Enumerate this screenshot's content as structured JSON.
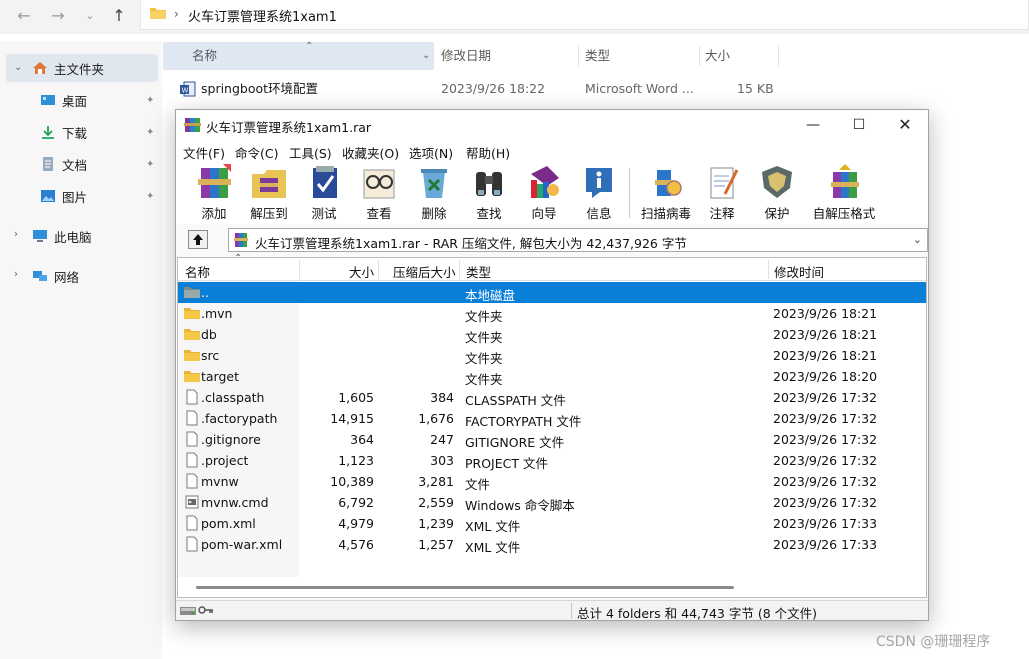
{
  "explorer": {
    "address_path": "火车订票管理系统1xam1",
    "sidebar": {
      "home": "主文件夹",
      "desktop": "桌面",
      "downloads": "下载",
      "documents": "文档",
      "pictures": "图片",
      "this_pc": "此电脑",
      "network": "网络"
    },
    "columns": {
      "name": "名称",
      "modified": "修改日期",
      "type": "类型",
      "size": "大小"
    },
    "file": {
      "name": "springboot环境配置",
      "modified": "2023/9/26 18:22",
      "type": "Microsoft Word ...",
      "size": "15 KB"
    }
  },
  "rar": {
    "title": "火车订票管理系统1xam1.rar",
    "menus": [
      "文件(F)",
      "命令(C)",
      "工具(S)",
      "收藏夹(O)",
      "选项(N)",
      "帮助(H)"
    ],
    "toolbar": [
      "添加",
      "解压到",
      "测试",
      "查看",
      "删除",
      "查找",
      "向导",
      "信息",
      "扫描病毒",
      "注释",
      "保护",
      "自解压格式"
    ],
    "path": "火车订票管理系统1xam1.rar - RAR 压缩文件, 解包大小为 42,437,926 字节",
    "columns": {
      "name": "名称",
      "size": "大小",
      "packed": "压缩后大小",
      "type": "类型",
      "modified": "修改时间"
    },
    "rows": [
      {
        "name": "..",
        "size": "",
        "packed": "",
        "type": "本地磁盘",
        "modified": "",
        "kind": "drive"
      },
      {
        "name": ".mvn",
        "size": "",
        "packed": "",
        "type": "文件夹",
        "modified": "2023/9/26 18:21",
        "kind": "folder"
      },
      {
        "name": "db",
        "size": "",
        "packed": "",
        "type": "文件夹",
        "modified": "2023/9/26 18:21",
        "kind": "folder"
      },
      {
        "name": "src",
        "size": "",
        "packed": "",
        "type": "文件夹",
        "modified": "2023/9/26 18:21",
        "kind": "folder"
      },
      {
        "name": "target",
        "size": "",
        "packed": "",
        "type": "文件夹",
        "modified": "2023/9/26 18:20",
        "kind": "folder"
      },
      {
        "name": ".classpath",
        "size": "1,605",
        "packed": "384",
        "type": "CLASSPATH 文件",
        "modified": "2023/9/26 17:32",
        "kind": "file"
      },
      {
        "name": ".factorypath",
        "size": "14,915",
        "packed": "1,676",
        "type": "FACTORYPATH 文件",
        "modified": "2023/9/26 17:32",
        "kind": "file"
      },
      {
        "name": ".gitignore",
        "size": "364",
        "packed": "247",
        "type": "GITIGNORE 文件",
        "modified": "2023/9/26 17:32",
        "kind": "file"
      },
      {
        "name": ".project",
        "size": "1,123",
        "packed": "303",
        "type": "PROJECT 文件",
        "modified": "2023/9/26 17:32",
        "kind": "file"
      },
      {
        "name": "mvnw",
        "size": "10,389",
        "packed": "3,281",
        "type": "文件",
        "modified": "2023/9/26 17:32",
        "kind": "file"
      },
      {
        "name": "mvnw.cmd",
        "size": "6,792",
        "packed": "2,559",
        "type": "Windows 命令脚本",
        "modified": "2023/9/26 17:32",
        "kind": "cmd"
      },
      {
        "name": "pom.xml",
        "size": "4,979",
        "packed": "1,239",
        "type": "XML 文件",
        "modified": "2023/9/26 17:33",
        "kind": "file"
      },
      {
        "name": "pom-war.xml",
        "size": "4,576",
        "packed": "1,257",
        "type": "XML 文件",
        "modified": "2023/9/26 17:33",
        "kind": "file"
      }
    ],
    "status": "总计 4 folders 和 44,743 字节 (8 个文件)"
  },
  "watermark": "CSDN @珊珊程序",
  "colors": {
    "selection": "#0a7fd8",
    "folder": "#f5c342",
    "explorer_sidebar": "#f7f7f7"
  }
}
